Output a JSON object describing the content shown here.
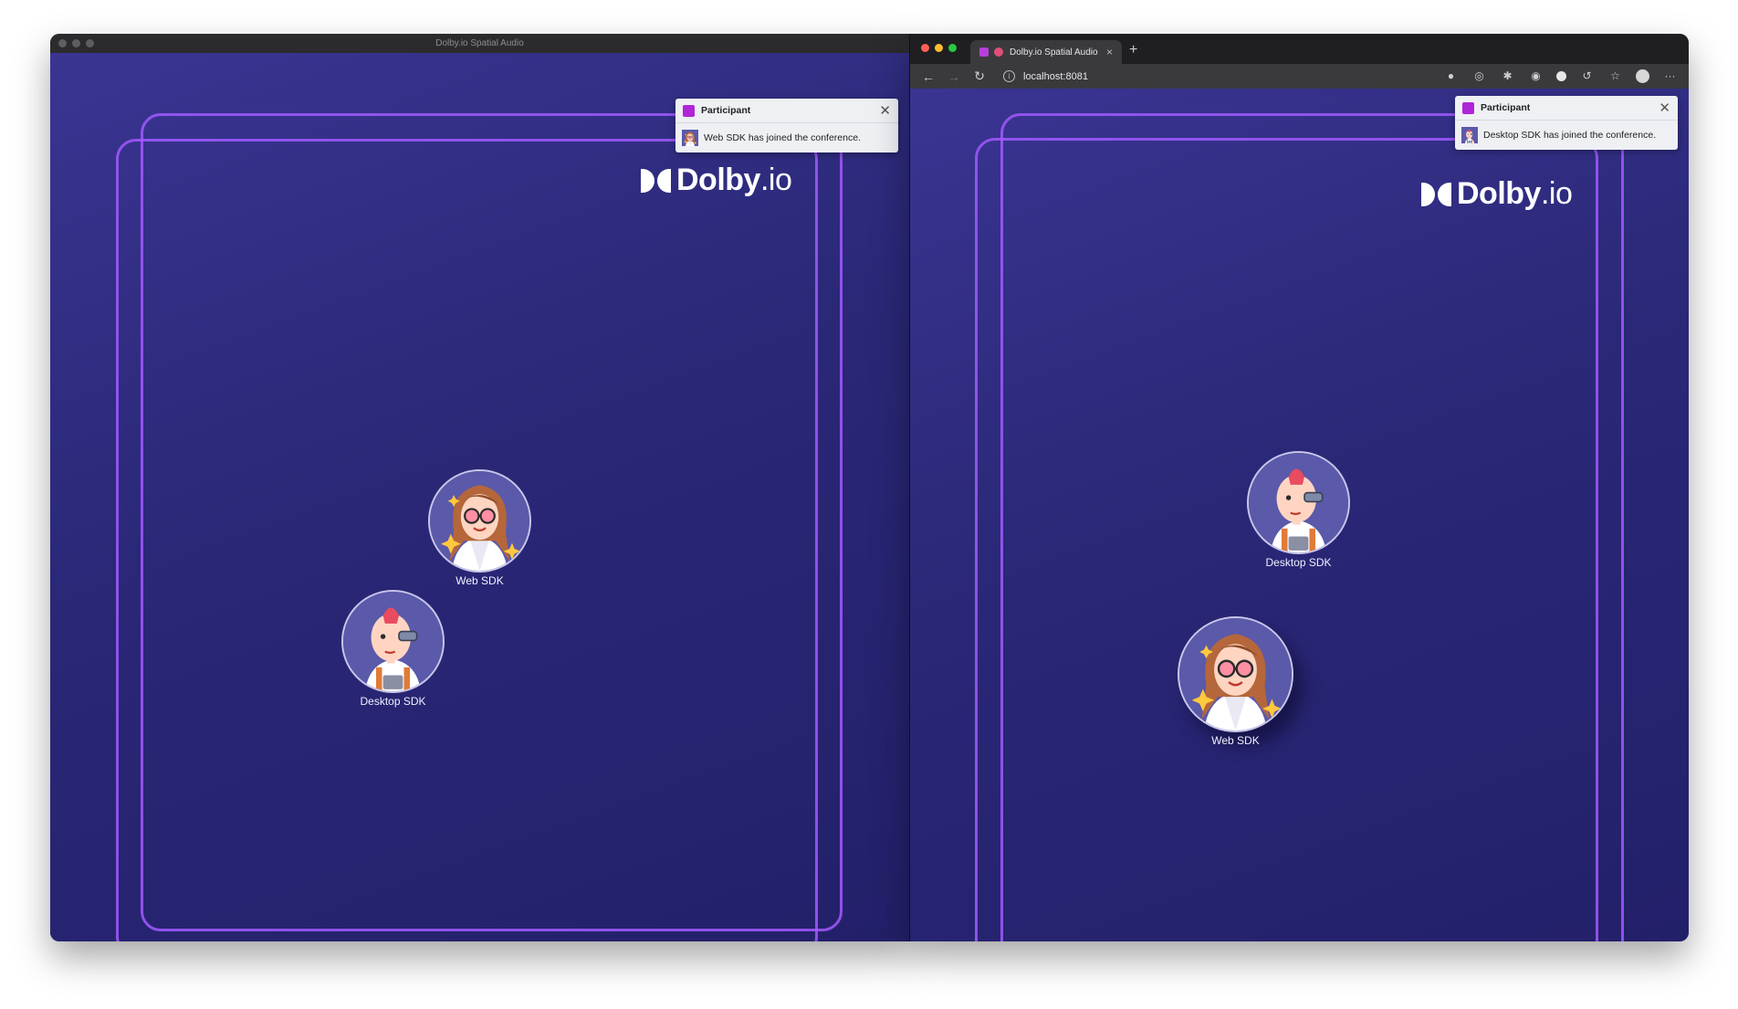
{
  "left_window": {
    "title": "Dolby.io Spatial Audio",
    "logo": {
      "brand": "Dolby",
      "suffix": ".io"
    },
    "toast": {
      "title": "Participant",
      "message": "Web SDK has joined the conference.",
      "close": "✕"
    },
    "participants": [
      {
        "name": "Web SDK",
        "avatar": "woman-with-glasses-icon"
      },
      {
        "name": "Desktop SDK",
        "avatar": "cyborg-man-icon"
      }
    ]
  },
  "right_window": {
    "tab": {
      "title": "Dolby.io Spatial Audio",
      "close": "×",
      "new_tab": "+"
    },
    "address": "localhost:8081",
    "nav": {
      "back": "←",
      "forward": "→",
      "reload": "↻"
    },
    "menu": "···",
    "logo": {
      "brand": "Dolby",
      "suffix": ".io"
    },
    "toast": {
      "title": "Participant",
      "message": "Desktop SDK has joined the conference.",
      "close": "✕"
    },
    "participants": [
      {
        "name": "Desktop SDK",
        "avatar": "cyborg-man-icon"
      },
      {
        "name": "Web SDK",
        "avatar": "woman-with-glasses-icon"
      }
    ]
  },
  "colors": {
    "background": "#2a2876",
    "frame": "#a259ff",
    "toast_accent": "#b025d8"
  }
}
